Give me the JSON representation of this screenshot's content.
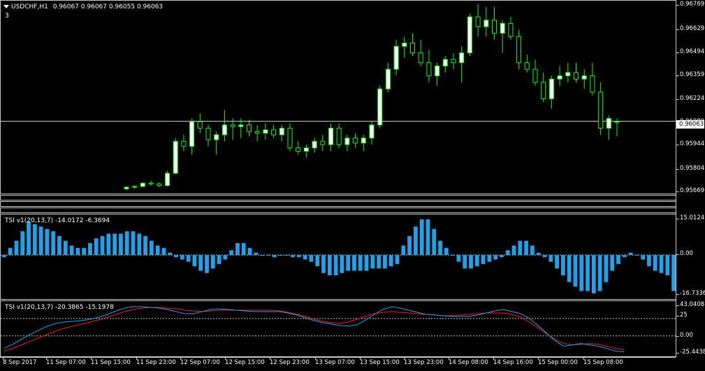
{
  "main": {
    "symbol_label": "USDCHF,H1",
    "ohlc_values": "0.96067 0.96067 0.96055 0.96063",
    "sub_label": "3",
    "current_price": "0.96063",
    "y_ticks": [
      "0.96769",
      "0.96629",
      "0.96494",
      "0.96359",
      "0.96224",
      "0.96089",
      "0.95944",
      "0.95804",
      "0.95669"
    ],
    "colors": {
      "candle": "#00ff00",
      "bull_body": "#ffffff",
      "bear_body": "#000000",
      "grid": "#ffffff"
    }
  },
  "tsi_hist": {
    "label": "TSI v1(20,13,7) -14.0172 -6.3694",
    "y_ticks": [
      "15.0124",
      "0.00",
      "-16.7336"
    ],
    "color": "#1fa2e8",
    "values": [
      -1,
      3,
      6,
      10,
      14,
      13,
      12,
      11,
      10,
      8,
      6,
      4,
      3,
      3,
      5,
      7,
      8,
      9,
      9,
      9,
      10,
      10,
      9,
      8,
      6,
      4,
      3,
      1,
      -1,
      -2,
      -3,
      -5,
      -7,
      -8,
      -6,
      -4,
      -2,
      2,
      5,
      5,
      3,
      1,
      0,
      0,
      -1,
      0,
      0,
      -1,
      -1,
      -2,
      -3,
      -5,
      -8,
      -9,
      -9,
      -8,
      -7,
      -7,
      -7,
      -7,
      -6,
      -6,
      -6,
      -5,
      -4,
      4,
      8,
      12,
      15,
      15,
      11,
      6,
      3,
      0,
      -3,
      -6,
      -6,
      -5,
      -4,
      -3,
      -2,
      -1,
      2,
      4,
      6,
      6,
      4,
      1,
      -1,
      -3,
      -6,
      -9,
      -12,
      -14,
      -16,
      -16,
      -17,
      -16,
      -12,
      -7,
      -4,
      -1,
      1,
      0,
      -2,
      -5,
      -7,
      -8,
      -9,
      -16
    ]
  },
  "tsi_lines": {
    "label": "TSI v1(20,13,7) -20.3865 -15.1978",
    "y_ticks": [
      "43.0408",
      "25",
      "0.00",
      "-25.4438"
    ],
    "blue_color": "#1fa2e8",
    "red_color": "#ff1a1a",
    "blue": [
      -18,
      -12,
      -5,
      2,
      8,
      14,
      18,
      20,
      21,
      22,
      24,
      27,
      31,
      36,
      40,
      42,
      42,
      41,
      40,
      38,
      35,
      32,
      32,
      35,
      38,
      39,
      38,
      37,
      36,
      35,
      35,
      35,
      35,
      33,
      30,
      26,
      22,
      19,
      17,
      15,
      14,
      16,
      23,
      31,
      38,
      42,
      40,
      37,
      34,
      31,
      30,
      29,
      28,
      28,
      28,
      30,
      33,
      36,
      38,
      35,
      32,
      25,
      15,
      4,
      -7,
      -15,
      -13,
      -11,
      -13,
      -15,
      -18,
      -22,
      -23
    ],
    "red": [
      -22,
      -18,
      -13,
      -8,
      -3,
      2,
      7,
      11,
      14,
      17,
      20,
      23,
      27,
      31,
      35,
      38,
      40,
      41,
      41,
      40,
      39,
      37,
      36,
      35,
      36,
      37,
      37,
      37,
      37,
      37,
      37,
      37,
      36,
      34,
      31,
      28,
      24,
      21,
      19,
      18,
      20,
      24,
      28,
      32,
      34,
      35,
      34,
      33,
      32,
      31,
      30,
      29,
      29,
      30,
      31,
      32,
      33,
      33,
      33,
      31,
      27,
      20,
      12,
      3,
      -5,
      -11,
      -13,
      -12,
      -11,
      -12,
      -15,
      -18,
      -20
    ]
  },
  "x_ticks": [
    "8 Sep 2017",
    "11 Sep 07:00",
    "11 Sep 15:00",
    "11 Sep 23:00",
    "12 Sep 07:00",
    "12 Sep 15:00",
    "12 Sep 23:00",
    "13 Sep 07:00",
    "13 Sep 15:00",
    "13 Sep 23:00",
    "14 Sep 08:00",
    "14 Sep 16:00",
    "15 Sep 00:00",
    "15 Sep 08:00"
  ],
  "candles": [
    [
      0.9565,
      0.95665,
      0.9564,
      0.9566
    ],
    [
      0.9566,
      0.95672,
      0.9565,
      0.95665
    ],
    [
      0.95665,
      0.9569,
      0.9566,
      0.95685
    ],
    [
      0.95685,
      0.957,
      0.9567,
      0.9568
    ],
    [
      0.9568,
      0.9569,
      0.9566,
      0.9567
    ],
    [
      0.9567,
      0.9576,
      0.95665,
      0.95745
    ],
    [
      0.95745,
      0.9596,
      0.9574,
      0.9594
    ],
    [
      0.9594,
      0.9598,
      0.9588,
      0.9591
    ],
    [
      0.9591,
      0.9608,
      0.9586,
      0.9606
    ],
    [
      0.9606,
      0.9611,
      0.9599,
      0.9602
    ],
    [
      0.9602,
      0.9604,
      0.9591,
      0.9595
    ],
    [
      0.9595,
      0.96,
      0.9586,
      0.9598
    ],
    [
      0.9598,
      0.9613,
      0.9594,
      0.9604
    ],
    [
      0.9604,
      0.9608,
      0.9595,
      0.9603
    ],
    [
      0.9603,
      0.9608,
      0.9596,
      0.9604
    ],
    [
      0.9604,
      0.9607,
      0.9597,
      0.96
    ],
    [
      0.96,
      0.9604,
      0.9594,
      0.9599
    ],
    [
      0.9599,
      0.9605,
      0.9595,
      0.9601
    ],
    [
      0.9601,
      0.9604,
      0.9596,
      0.9598
    ],
    [
      0.9598,
      0.9604,
      0.9594,
      0.9602
    ],
    [
      0.9602,
      0.9605,
      0.9588,
      0.959
    ],
    [
      0.959,
      0.9594,
      0.9586,
      0.9588
    ],
    [
      0.9588,
      0.9592,
      0.9584,
      0.959
    ],
    [
      0.959,
      0.9596,
      0.9587,
      0.9594
    ],
    [
      0.9594,
      0.9598,
      0.9588,
      0.9592
    ],
    [
      0.9592,
      0.9605,
      0.9588,
      0.9602
    ],
    [
      0.9602,
      0.9605,
      0.959,
      0.9592
    ],
    [
      0.9592,
      0.9598,
      0.9588,
      0.9596
    ],
    [
      0.9596,
      0.9599,
      0.959,
      0.9593
    ],
    [
      0.9593,
      0.9598,
      0.9588,
      0.9596
    ],
    [
      0.9596,
      0.9606,
      0.9592,
      0.9604
    ],
    [
      0.9604,
      0.9628,
      0.9602,
      0.9626
    ],
    [
      0.9626,
      0.9642,
      0.9624,
      0.9638
    ],
    [
      0.9638,
      0.9656,
      0.9634,
      0.9652
    ],
    [
      0.9652,
      0.9658,
      0.9645,
      0.9654
    ],
    [
      0.9654,
      0.966,
      0.9646,
      0.9648
    ],
    [
      0.9648,
      0.9656,
      0.964,
      0.9642
    ],
    [
      0.9642,
      0.965,
      0.963,
      0.9634
    ],
    [
      0.9634,
      0.9642,
      0.9628,
      0.964
    ],
    [
      0.964,
      0.9646,
      0.9636,
      0.9644
    ],
    [
      0.9644,
      0.9648,
      0.9638,
      0.9642
    ],
    [
      0.9642,
      0.9652,
      0.963,
      0.9648
    ],
    [
      0.9648,
      0.9672,
      0.9646,
      0.967
    ],
    [
      0.967,
      0.9678,
      0.9658,
      0.9664
    ],
    [
      0.9664,
      0.9676,
      0.9658,
      0.9668
    ],
    [
      0.9668,
      0.9676,
      0.9656,
      0.966
    ],
    [
      0.966,
      0.9668,
      0.9648,
      0.9666
    ],
    [
      0.9666,
      0.967,
      0.9656,
      0.9658
    ],
    [
      0.9658,
      0.9662,
      0.9638,
      0.9642
    ],
    [
      0.9642,
      0.9647,
      0.9636,
      0.9638
    ],
    [
      0.9638,
      0.9644,
      0.9628,
      0.963
    ],
    [
      0.963,
      0.9636,
      0.9618,
      0.962
    ],
    [
      0.962,
      0.9634,
      0.9614,
      0.9632
    ],
    [
      0.9632,
      0.964,
      0.9628,
      0.9634
    ],
    [
      0.9634,
      0.9642,
      0.963,
      0.9636
    ],
    [
      0.9636,
      0.9642,
      0.963,
      0.9632
    ],
    [
      0.9632,
      0.9638,
      0.9626,
      0.9634
    ],
    [
      0.9634,
      0.9642,
      0.9622,
      0.9624
    ],
    [
      0.9624,
      0.963,
      0.9598,
      0.9602
    ],
    [
      0.9602,
      0.961,
      0.9595,
      0.9608
    ],
    [
      0.9606,
      0.9608,
      0.9597,
      0.9606
    ]
  ],
  "price_range": [
    0.9563,
    0.9679
  ]
}
